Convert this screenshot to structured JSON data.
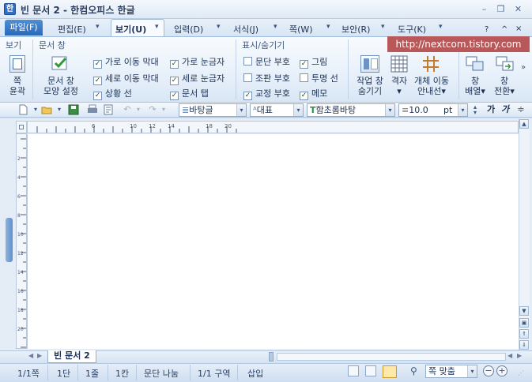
{
  "window": {
    "icon_glyph": "한",
    "title": "빈 문서 2 - 한컴오피스 한글",
    "minimize": "–",
    "restore": "❐",
    "close": "✕"
  },
  "menu": {
    "file": "파일(F)",
    "edit": "편집(E)",
    "view": "보기(U)",
    "input": "입력(D)",
    "format": "서식(J)",
    "page": "쪽(W)",
    "security": "보안(R)",
    "tools": "도구(K)",
    "arrow": "▾",
    "help": "?",
    "up": "^",
    "pin": "×"
  },
  "watermark": "http://nextcom.tistory.com",
  "ribbon": {
    "group_view": "보기",
    "group_docwin": "문서 창",
    "group_display": "표시/숨기기",
    "fit_page_label_1": "쪽",
    "fit_page_label_2": "윤곽",
    "docwin_setting_label_1": "문서 창",
    "docwin_setting_label_2": "모양 설정",
    "checks_col1": [
      {
        "label": "가로 이동 막대",
        "checked": true
      },
      {
        "label": "세로 이동 막대",
        "checked": true
      },
      {
        "label": "상황 선",
        "checked": true
      }
    ],
    "checks_col2": [
      {
        "label": "가로 눈금자",
        "checked": true
      },
      {
        "label": "세로 눈금자",
        "checked": true
      },
      {
        "label": "문서 탭",
        "checked": true
      }
    ],
    "checks_col3": [
      {
        "label": "문단 부호",
        "checked": false
      },
      {
        "label": "조판 부호",
        "checked": false
      },
      {
        "label": "교정 부호",
        "checked": true
      }
    ],
    "checks_col4": [
      {
        "label": "그림",
        "checked": true
      },
      {
        "label": "투명 선",
        "checked": false
      },
      {
        "label": "메모",
        "checked": true
      }
    ],
    "taskpane_label_1": "작업 창",
    "taskpane_label_2": "숨기기",
    "grid_label_1": "격자",
    "grid_label_2": "▾",
    "objmove_label_1": "개체 이동",
    "objmove_label_2": "안내선▾",
    "arrange_label_1": "창",
    "arrange_label_2": "배열▾",
    "switch_label_1": "창",
    "switch_label_2": "전환▾",
    "more": "»",
    "check_mark": "✓"
  },
  "toolbar": {
    "style": "바탕글",
    "font_lang": "대표",
    "font": "함초롬바탕",
    "size": "10.0",
    "size_unit": "pt",
    "bold": "가",
    "italic": "가",
    "more": "≑"
  },
  "ruler": {
    "h_labels": [
      "2",
      "4",
      "6",
      "8",
      "10",
      "12",
      "14",
      "16",
      "18",
      "20"
    ],
    "v_labels": [
      "2",
      "4",
      "6",
      "8",
      "10",
      "12",
      "14",
      "16",
      "18",
      "20"
    ]
  },
  "doc_tabs": {
    "active": "빈 문서 2"
  },
  "status": {
    "page": "1/1쪽",
    "column": "1단",
    "line": "1줄",
    "col_pos": "1칸",
    "para_split": "문단 나눔",
    "section": "1/1 구역",
    "mode": "삽입",
    "zoom": "쪽 맞춤"
  }
}
